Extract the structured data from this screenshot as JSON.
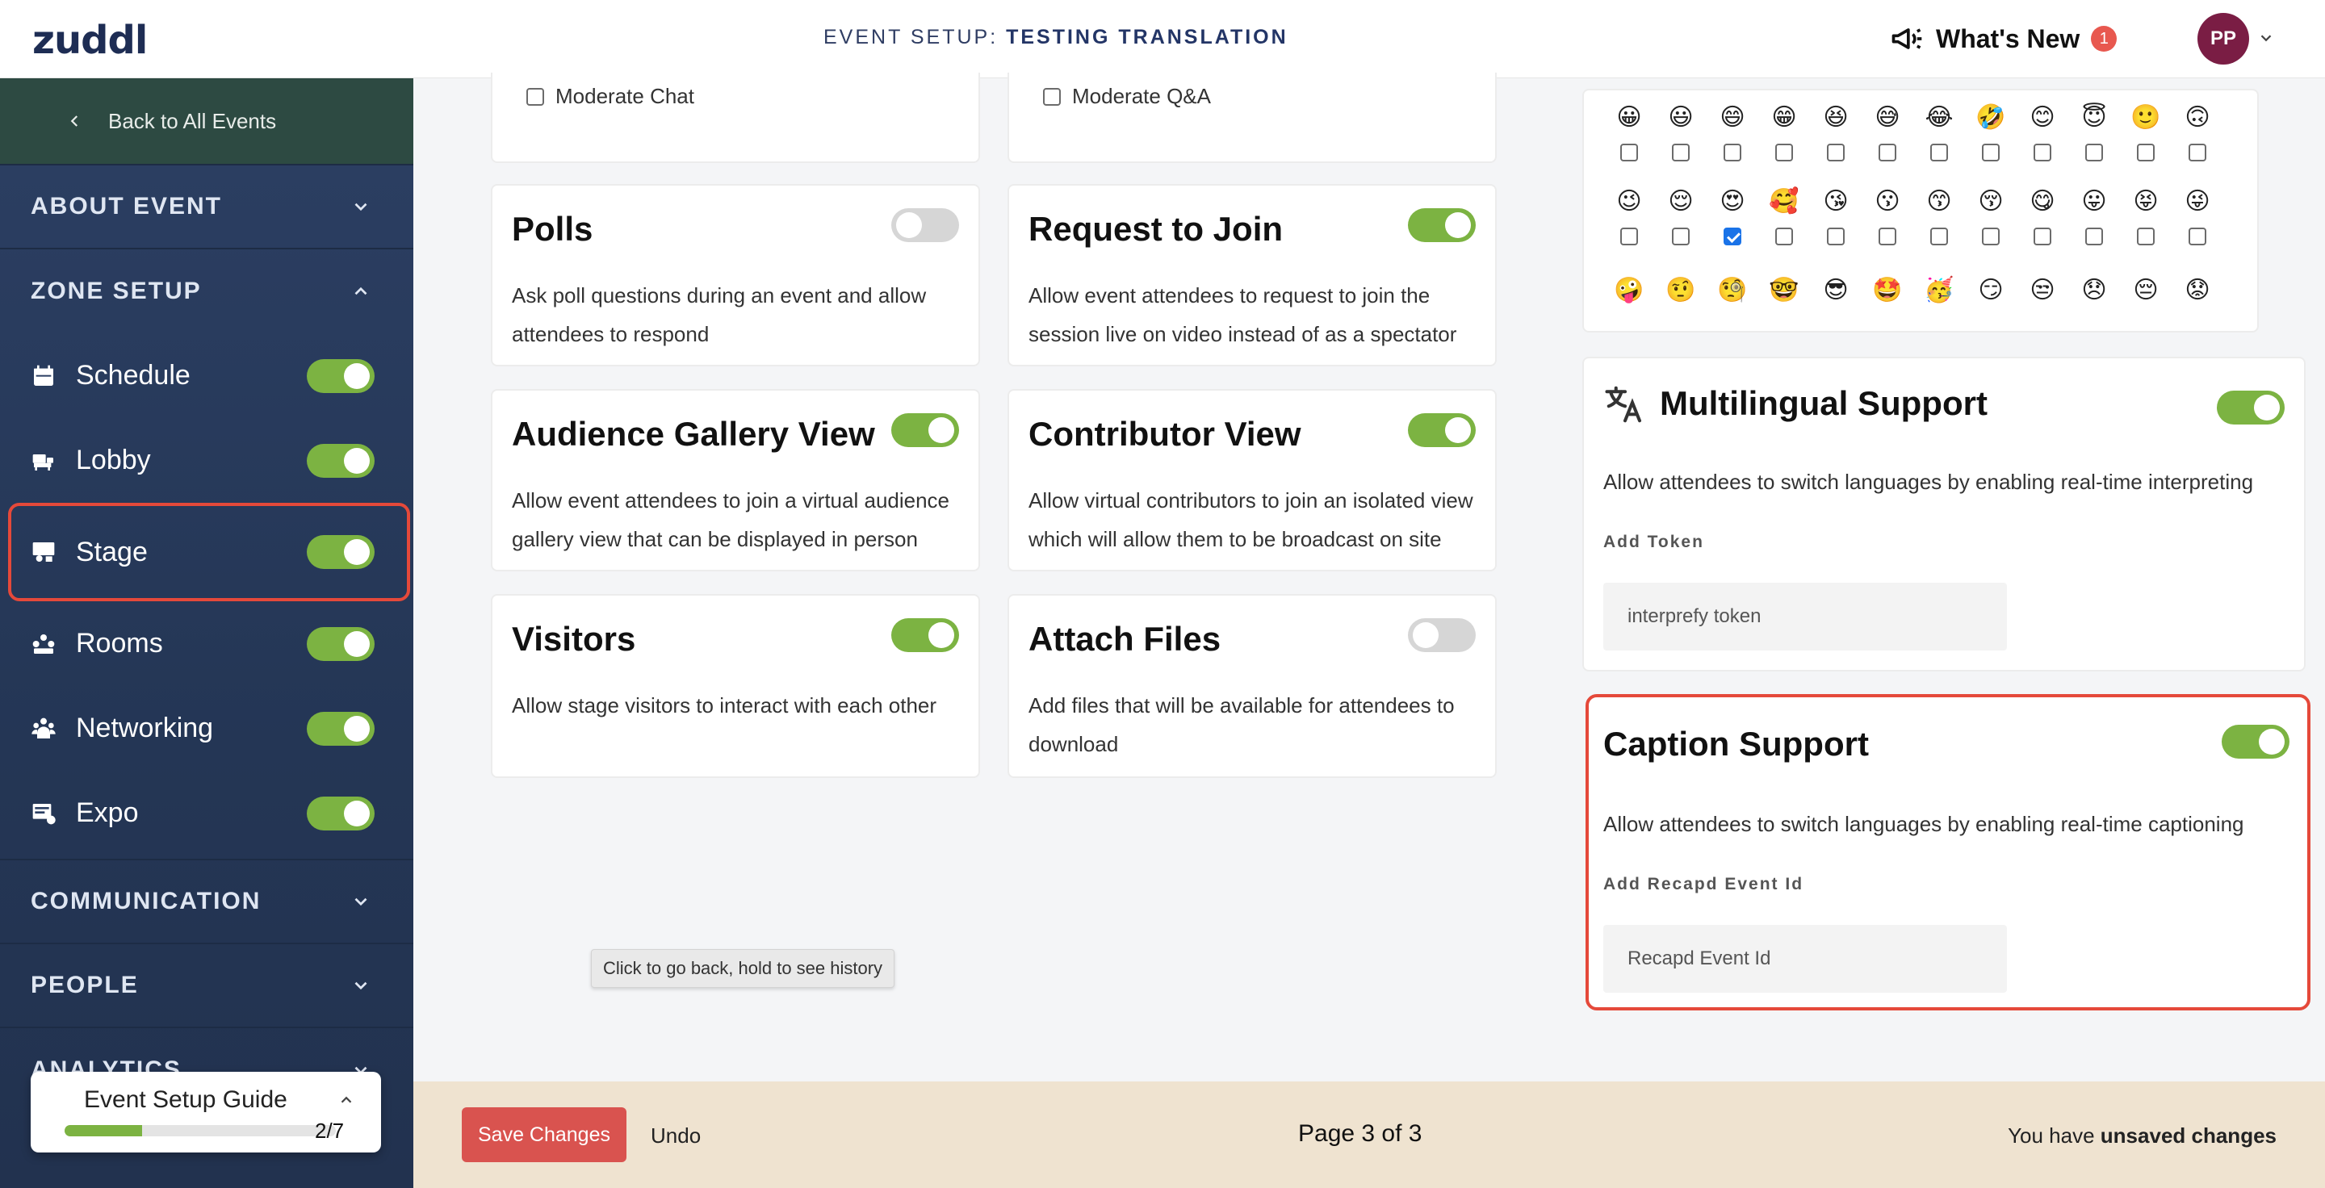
{
  "header": {
    "logo": "zuddl",
    "event_prefix": "EVENT SETUP:",
    "event_name": "TESTING TRANSLATION",
    "whats_new": "What's New",
    "whats_new_count": "1",
    "avatar_initials": "PP"
  },
  "sidebar": {
    "back_label": "Back to All Events",
    "sections": {
      "about": "ABOUT EVENT",
      "zone_setup": "ZONE SETUP",
      "communication": "COMMUNICATION",
      "people": "PEOPLE",
      "analytics": "ANALYTICS"
    },
    "zones": [
      {
        "label": "Schedule",
        "icon": "calendar-icon",
        "enabled": true
      },
      {
        "label": "Lobby",
        "icon": "lobby-icon",
        "enabled": true
      },
      {
        "label": "Stage",
        "icon": "stage-icon",
        "enabled": true,
        "active": true
      },
      {
        "label": "Rooms",
        "icon": "rooms-icon",
        "enabled": true
      },
      {
        "label": "Networking",
        "icon": "networking-icon",
        "enabled": true
      },
      {
        "label": "Expo",
        "icon": "expo-icon",
        "enabled": true
      }
    ],
    "guide": {
      "title": "Event Setup Guide",
      "progress": "2/7",
      "progress_fraction": 0.2857
    }
  },
  "main": {
    "moderate_chat": "Moderate Chat",
    "moderate_qa": "Moderate Q&A",
    "features": [
      {
        "title": "Polls",
        "desc": "Ask poll questions during an event and allow attendees to respond",
        "enabled": false
      },
      {
        "title": "Request to Join",
        "desc": "Allow event attendees to request to join the session live on video instead of as a spectator",
        "enabled": true
      },
      {
        "title": "Audience Gallery View",
        "desc": "Allow event attendees to join a virtual audience gallery view that can be displayed in person",
        "enabled": true
      },
      {
        "title": "Contributor View",
        "desc": "Allow virtual contributors to join an isolated view which will allow them to be broadcast on site",
        "enabled": true
      },
      {
        "title": "Visitors",
        "desc": "Allow stage visitors to interact with each other",
        "enabled": true
      },
      {
        "title": "Attach Files",
        "desc": "Add files that will be available for attendees to download",
        "enabled": false
      }
    ],
    "emoji_rows": [
      [
        "😀",
        "😃",
        "😄",
        "😁",
        "😆",
        "😅",
        "😂",
        "🤣",
        "😊",
        "😇",
        "🙂",
        "🙃"
      ],
      [
        "😉",
        "😌",
        "😍",
        "🥰",
        "😘",
        "😗",
        "😙",
        "😚",
        "😋",
        "😛",
        "😝",
        "😜"
      ],
      [
        "🤪",
        "🤨",
        "🧐",
        "🤓",
        "😎",
        "🤩",
        "🥳",
        "😏",
        "😒",
        "😞",
        "😔",
        "😟"
      ]
    ],
    "emoji_checked": {
      "row": 1,
      "col": 2
    },
    "multilingual": {
      "title": "Multilingual Support",
      "desc": "Allow attendees to switch languages by enabling real-time interpreting",
      "field_label": "Add Token",
      "placeholder": "interprefy token",
      "enabled": true
    },
    "caption": {
      "title": "Caption Support",
      "desc": "Allow attendees to switch languages by enabling real-time captioning",
      "field_label": "Add Recapd Event Id",
      "placeholder": "Recapd Event Id",
      "enabled": true
    },
    "tooltip": "Click to go back, hold to see history"
  },
  "footer": {
    "save_label": "Save Changes",
    "undo_label": "Undo",
    "page_indicator": "Page 3 of 3",
    "unsaved_prefix": "You have",
    "unsaved_strong": "unsaved changes"
  },
  "colors": {
    "accent_green": "#7cb342",
    "highlight_red": "#e5493a",
    "sidebar_bg": "#263a5c",
    "save_button": "#d9534f"
  }
}
